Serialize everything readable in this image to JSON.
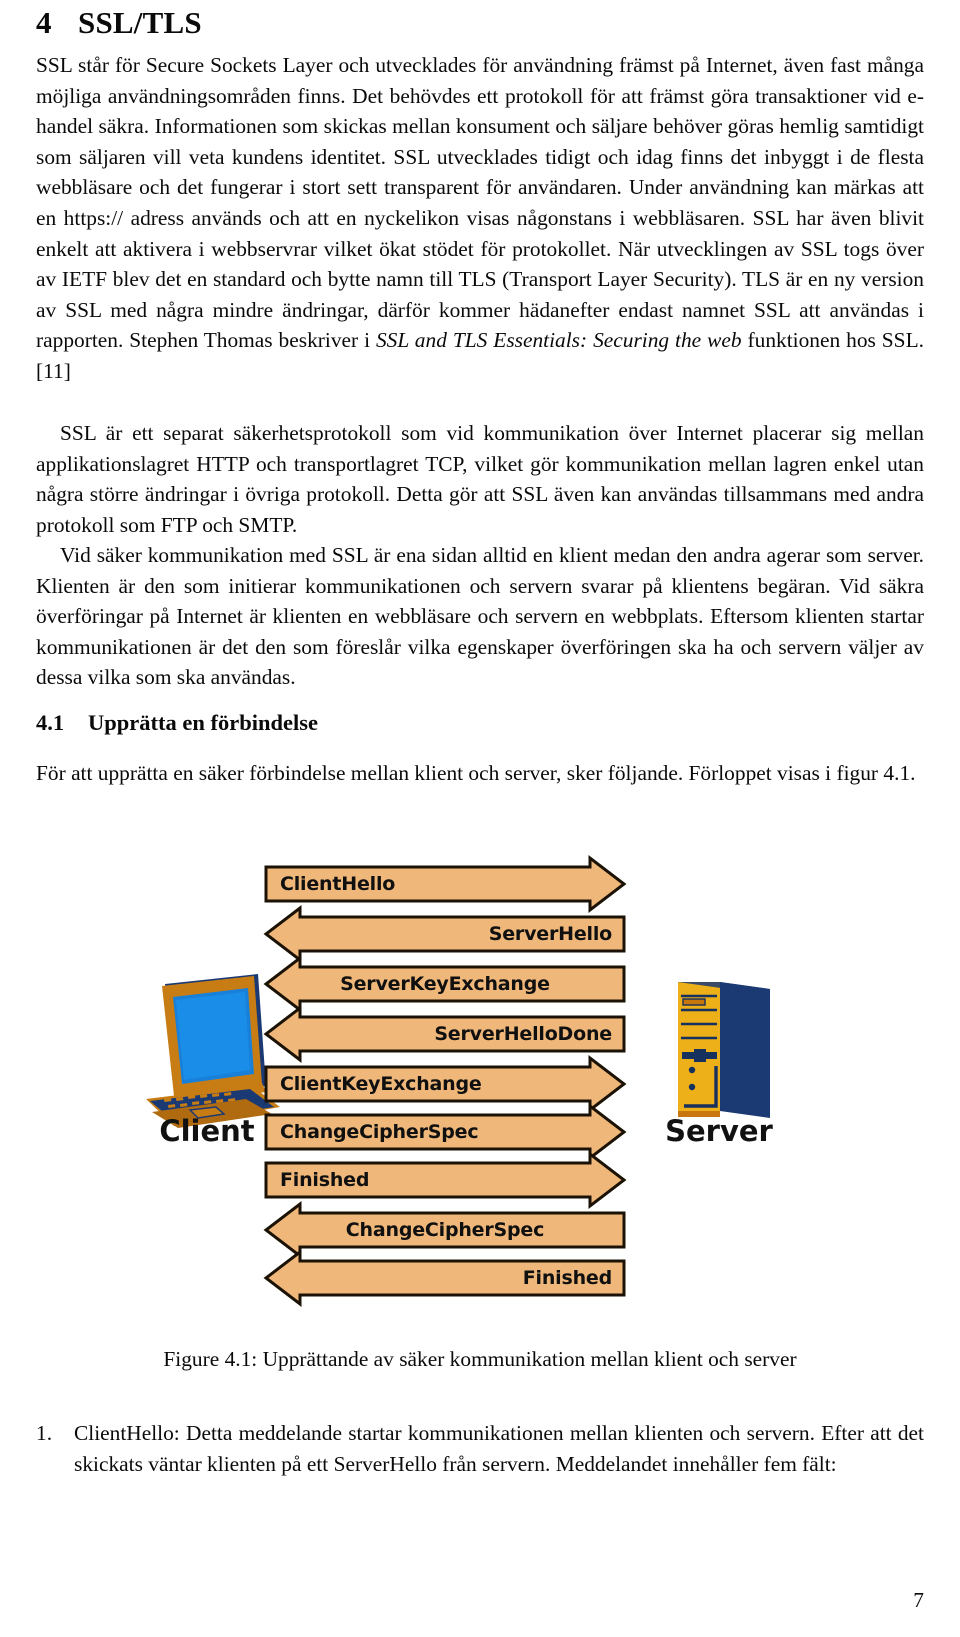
{
  "section": {
    "number": "4",
    "title": "SSL/TLS"
  },
  "paragraphs": [
    "SSL står för Secure Sockets Layer och utvecklades för användning främst på Internet, även fast många möjliga användningsområden finns.  Det behövdes ett protokoll för att främst göra transaktioner vid e-handel säkra.  Informationen som skickas mellan konsument och säljare behöver göras hemlig samtidigt som säljaren vill veta kundens identitet.  SSL utvecklades tidigt och idag finns det inbyggt i de flesta webbläsare och det fungerar i stort sett transparent för användaren.  Under användning kan märkas att en https:// adress används och att en nyckelikon visas någonstans i webbläsaren.  SSL har även blivit enkelt att aktivera i webbservrar vilket ökat stödet för protokollet. När utvecklingen av SSL togs över av IETF blev det en standard och bytte namn till TLS (Transport Layer Security).  TLS är en ny version av SSL med några mindre ändringar, därför kommer hädanefter endast namnet SSL att användas i rapporten. Stephen Thomas beskriver i ",
    "SSL är ett separat säkerhetsprotokoll som vid kommunikation över Internet placerar sig mellan applikationslagret HTTP och transportlagret TCP, vilket gör kommunikation mellan lagren enkel utan några större ändringar i övriga protokoll. Detta gör att SSL även kan användas tillsammans med andra protokoll som FTP och SMTP.",
    "Vid säker kommunikation med SSL är ena sidan alltid en klient medan den andra agerar som server.  Klienten är den som initierar kommunikationen och servern svarar på klientens begäran.  Vid säkra överföringar på Internet är klienten en webbläsare och servern en webbplats. Eftersom klienten startar kommunikationen är det den som föreslår vilka egenskaper överföringen ska ha och servern väljer av dessa vilka som ska användas."
  ],
  "citation": {
    "italic_title": "SSL and TLS Essentials: Securing the web",
    "after": " funktionen hos SSL. [11]"
  },
  "subsection": {
    "number": "4.1",
    "title": "Upprätta en förbindelse"
  },
  "subsection_para": "För att upprätta en säker förbindelse mellan klient och server, sker följande.  Förloppet visas i figur 4.1.",
  "figure": {
    "caption": "Figure 4.1: Upprättande av säker kommunikation mellan klient och server",
    "client_label": "Client",
    "server_label": "Server",
    "arrow_fill": "#EFB87A",
    "arrow_stroke": "#1b1205",
    "messages": [
      {
        "label": "ClientHello",
        "direction": "right",
        "text_side": "left"
      },
      {
        "label": "ServerHello",
        "direction": "left",
        "text_side": "right"
      },
      {
        "label": "ServerKeyExchange",
        "direction": "left",
        "text_side": "center"
      },
      {
        "label": "ServerHelloDone",
        "direction": "left",
        "text_side": "right"
      },
      {
        "label": "ClientKeyExchange",
        "direction": "right",
        "text_side": "left"
      },
      {
        "label": "ChangeCipherSpec",
        "direction": "right",
        "text_side": "left"
      },
      {
        "label": "Finished",
        "direction": "right",
        "text_side": "left"
      },
      {
        "label": "ChangeCipherSpec",
        "direction": "left",
        "text_side": "center"
      },
      {
        "label": "Finished",
        "direction": "left",
        "text_side": "right"
      }
    ]
  },
  "list": [
    {
      "marker": "1.",
      "text": "ClientHello: Detta meddelande startar kommunikationen mellan klienten och servern. Efter att det skickats väntar klienten på ett ServerHello från servern.  Meddelandet innehåller fem fält:"
    }
  ],
  "page_number": "7"
}
